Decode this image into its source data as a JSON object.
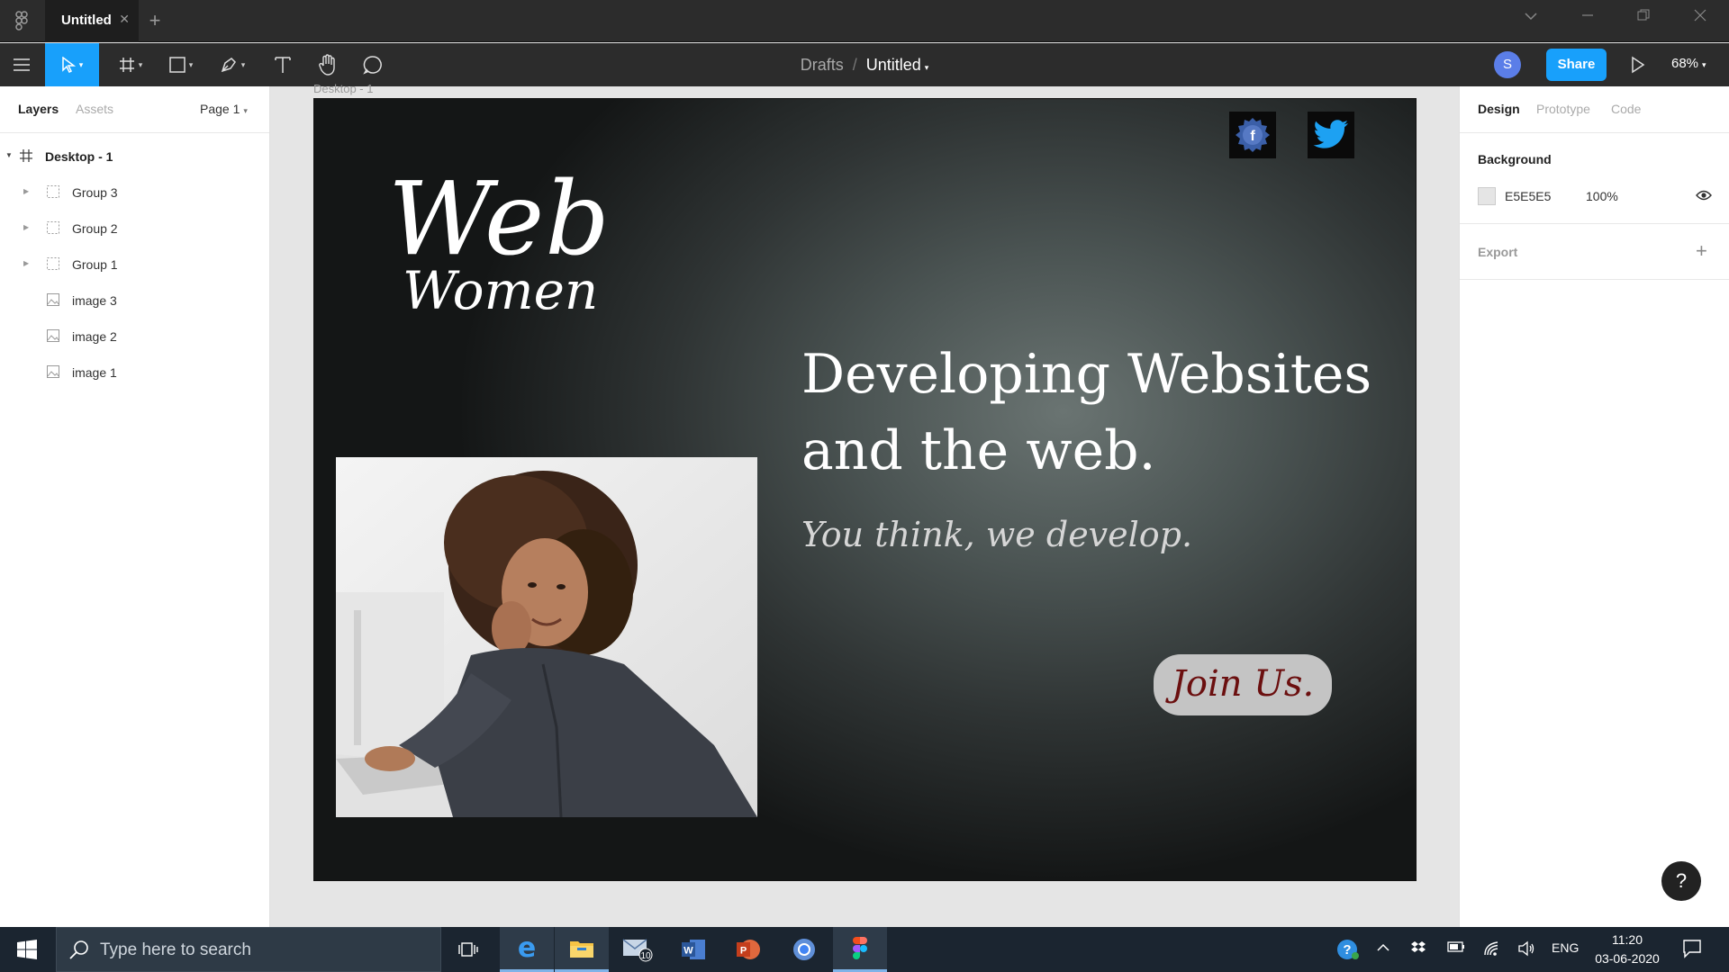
{
  "window": {
    "tab_title": "Untitled",
    "tab_close": "✕",
    "tab_add": "+"
  },
  "toolbar": {
    "breadcrumb_root": "Drafts",
    "breadcrumb_sep": "/",
    "file_name": "Untitled",
    "avatar_initial": "S",
    "share_label": "Share",
    "zoom_level": "68%"
  },
  "left_panel": {
    "tab_layers": "Layers",
    "tab_assets": "Assets",
    "page_selector": "Page 1",
    "layers": [
      {
        "name": "Desktop - 1",
        "type": "frame"
      },
      {
        "name": "Group 3",
        "type": "group"
      },
      {
        "name": "Group 2",
        "type": "group"
      },
      {
        "name": "Group 1",
        "type": "group"
      },
      {
        "name": "image 3",
        "type": "image"
      },
      {
        "name": "image 2",
        "type": "image"
      },
      {
        "name": "image 1",
        "type": "image"
      }
    ]
  },
  "canvas": {
    "frame_label": "Desktop - 1",
    "logo_line1": "Web",
    "logo_line2": "Women",
    "headline": "Developing Websites and the web.",
    "tagline": "You think, we develop.",
    "cta_label": "Join Us.",
    "social_icons": [
      "facebook-icon",
      "twitter-icon"
    ],
    "facebook_letter": "f"
  },
  "right_panel": {
    "tab_design": "Design",
    "tab_prototype": "Prototype",
    "tab_code": "Code",
    "background_label": "Background",
    "background_hex": "E5E5E5",
    "background_opacity": "100%",
    "export_label": "Export",
    "export_add": "+"
  },
  "help_label": "?",
  "taskbar": {
    "search_placeholder": "Type here to search",
    "mail_badge": "10",
    "language": "ENG",
    "time": "11:20",
    "date": "03-06-2020"
  },
  "colors": {
    "accent": "#18a0fb",
    "cta_text": "#6b0f0f",
    "cta_bg": "#c4c4c4"
  }
}
